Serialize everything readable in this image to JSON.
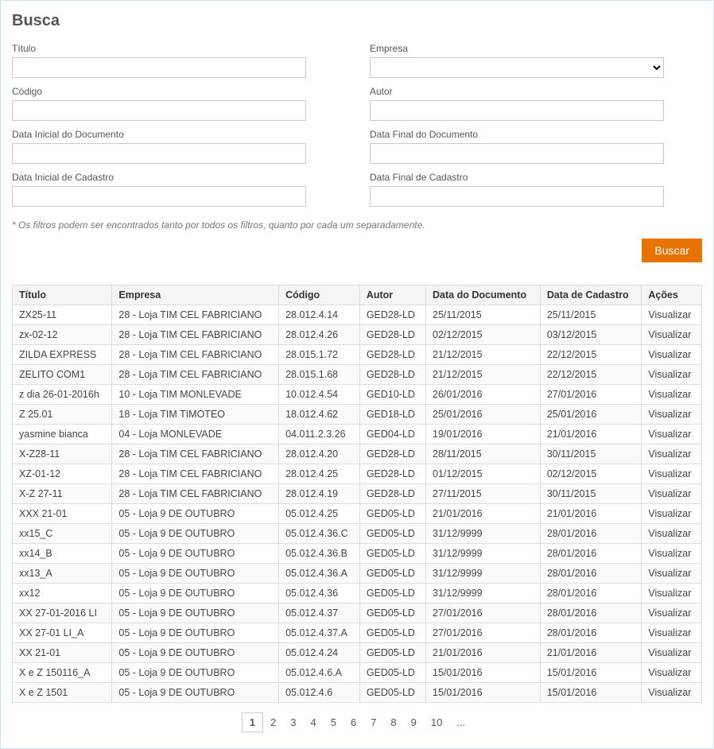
{
  "heading": "Busca",
  "labels": {
    "titulo": "Título",
    "empresa": "Empresa",
    "codigo": "Código",
    "autor": "Autor",
    "dataInicialDocumento": "Data Inicial do Documento",
    "dataFinalDocumento": "Data Final do Documento",
    "dataInicialCadastro": "Data Inicial de Cadastro",
    "dataFinalCadastro": "Data Final de Cadastro"
  },
  "hint": "* Os filtros podem ser encontrados tanto por todos os filtros, quanto por cada um separadamente.",
  "buttons": {
    "search": "Buscar",
    "view": "Visualizar"
  },
  "columns": {
    "titulo": "Título",
    "empresa": "Empresa",
    "codigo": "Código",
    "autor": "Autor",
    "dataDocumento": "Data do Documento",
    "dataCadastro": "Data de Cadastro",
    "acoes": "Ações"
  },
  "rows": [
    {
      "titulo": "ZX25-11",
      "empresa": "28 - Loja TIM CEL FABRICIANO",
      "codigo": "28.012.4.14",
      "autor": "GED28-LD",
      "dataDoc": "25/11/2015",
      "dataCad": "25/11/2015"
    },
    {
      "titulo": "zx-02-12",
      "empresa": "28 - Loja TIM CEL FABRICIANO",
      "codigo": "28.012.4.26",
      "autor": "GED28-LD",
      "dataDoc": "02/12/2015",
      "dataCad": "03/12/2015"
    },
    {
      "titulo": "ZILDA EXPRESS",
      "empresa": "28 - Loja TIM CEL FABRICIANO",
      "codigo": "28.015.1.72",
      "autor": "GED28-LD",
      "dataDoc": "21/12/2015",
      "dataCad": "22/12/2015"
    },
    {
      "titulo": "ZELITO COM1",
      "empresa": "28 - Loja TIM CEL FABRICIANO",
      "codigo": "28.015.1.68",
      "autor": "GED28-LD",
      "dataDoc": "21/12/2015",
      "dataCad": "22/12/2015"
    },
    {
      "titulo": "z dia 26-01-2016h",
      "empresa": "10 - Loja TIM MONLEVADE",
      "codigo": "10.012.4.54",
      "autor": "GED10-LD",
      "dataDoc": "26/01/2016",
      "dataCad": "27/01/2016"
    },
    {
      "titulo": "Z 25.01",
      "empresa": "18 - Loja TIM TIMOTEO",
      "codigo": "18.012.4.62",
      "autor": "GED18-LD",
      "dataDoc": "25/01/2016",
      "dataCad": "25/01/2016"
    },
    {
      "titulo": "yasmine bianca",
      "empresa": "04 - Loja MONLEVADE",
      "codigo": "04.011.2.3.26",
      "autor": "GED04-LD",
      "dataDoc": "19/01/2016",
      "dataCad": "21/01/2016"
    },
    {
      "titulo": "X-Z28-11",
      "empresa": "28 - Loja TIM CEL FABRICIANO",
      "codigo": "28.012.4.20",
      "autor": "GED28-LD",
      "dataDoc": "28/11/2015",
      "dataCad": "30/11/2015"
    },
    {
      "titulo": "XZ-01-12",
      "empresa": "28 - Loja TIM CEL FABRICIANO",
      "codigo": "28.012.4.25",
      "autor": "GED28-LD",
      "dataDoc": "01/12/2015",
      "dataCad": "02/12/2015"
    },
    {
      "titulo": "X-Z 27-11",
      "empresa": "28 - Loja TIM CEL FABRICIANO",
      "codigo": "28.012.4.19",
      "autor": "GED28-LD",
      "dataDoc": "27/11/2015",
      "dataCad": "30/11/2015"
    },
    {
      "titulo": "XXX 21-01",
      "empresa": "05 - Loja 9 DE OUTUBRO",
      "codigo": "05.012.4.25",
      "autor": "GED05-LD",
      "dataDoc": "21/01/2016",
      "dataCad": "21/01/2016"
    },
    {
      "titulo": "xx15_C",
      "empresa": "05 - Loja 9 DE OUTUBRO",
      "codigo": "05.012.4.36.C",
      "autor": "GED05-LD",
      "dataDoc": "31/12/9999",
      "dataCad": "28/01/2016"
    },
    {
      "titulo": "xx14_B",
      "empresa": "05 - Loja 9 DE OUTUBRO",
      "codigo": "05.012.4.36.B",
      "autor": "GED05-LD",
      "dataDoc": "31/12/9999",
      "dataCad": "28/01/2016"
    },
    {
      "titulo": "xx13_A",
      "empresa": "05 - Loja 9 DE OUTUBRO",
      "codigo": "05.012.4.36.A",
      "autor": "GED05-LD",
      "dataDoc": "31/12/9999",
      "dataCad": "28/01/2016"
    },
    {
      "titulo": "xx12",
      "empresa": "05 - Loja 9 DE OUTUBRO",
      "codigo": "05.012.4.36",
      "autor": "GED05-LD",
      "dataDoc": "31/12/9999",
      "dataCad": "28/01/2016"
    },
    {
      "titulo": "XX 27-01-2016 LI",
      "empresa": "05 - Loja 9 DE OUTUBRO",
      "codigo": "05.012.4.37",
      "autor": "GED05-LD",
      "dataDoc": "27/01/2016",
      "dataCad": "28/01/2016"
    },
    {
      "titulo": "XX 27-01 LI_A",
      "empresa": "05 - Loja 9 DE OUTUBRO",
      "codigo": "05.012.4.37.A",
      "autor": "GED05-LD",
      "dataDoc": "27/01/2016",
      "dataCad": "28/01/2016"
    },
    {
      "titulo": "XX 21-01",
      "empresa": "05 - Loja 9 DE OUTUBRO",
      "codigo": "05.012.4.24",
      "autor": "GED05-LD",
      "dataDoc": "21/01/2016",
      "dataCad": "21/01/2016"
    },
    {
      "titulo": "X e Z 150116_A",
      "empresa": "05 - Loja 9 DE OUTUBRO",
      "codigo": "05.012.4.6.A",
      "autor": "GED05-LD",
      "dataDoc": "15/01/2016",
      "dataCad": "15/01/2016"
    },
    {
      "titulo": "X e Z 1501",
      "empresa": "05 - Loja 9 DE OUTUBRO",
      "codigo": "05.012.4.6",
      "autor": "GED05-LD",
      "dataDoc": "15/01/2016",
      "dataCad": "15/01/2016"
    }
  ],
  "pager": {
    "pages": [
      "1",
      "2",
      "3",
      "4",
      "5",
      "6",
      "7",
      "8",
      "9",
      "10",
      "..."
    ],
    "active": "1"
  }
}
